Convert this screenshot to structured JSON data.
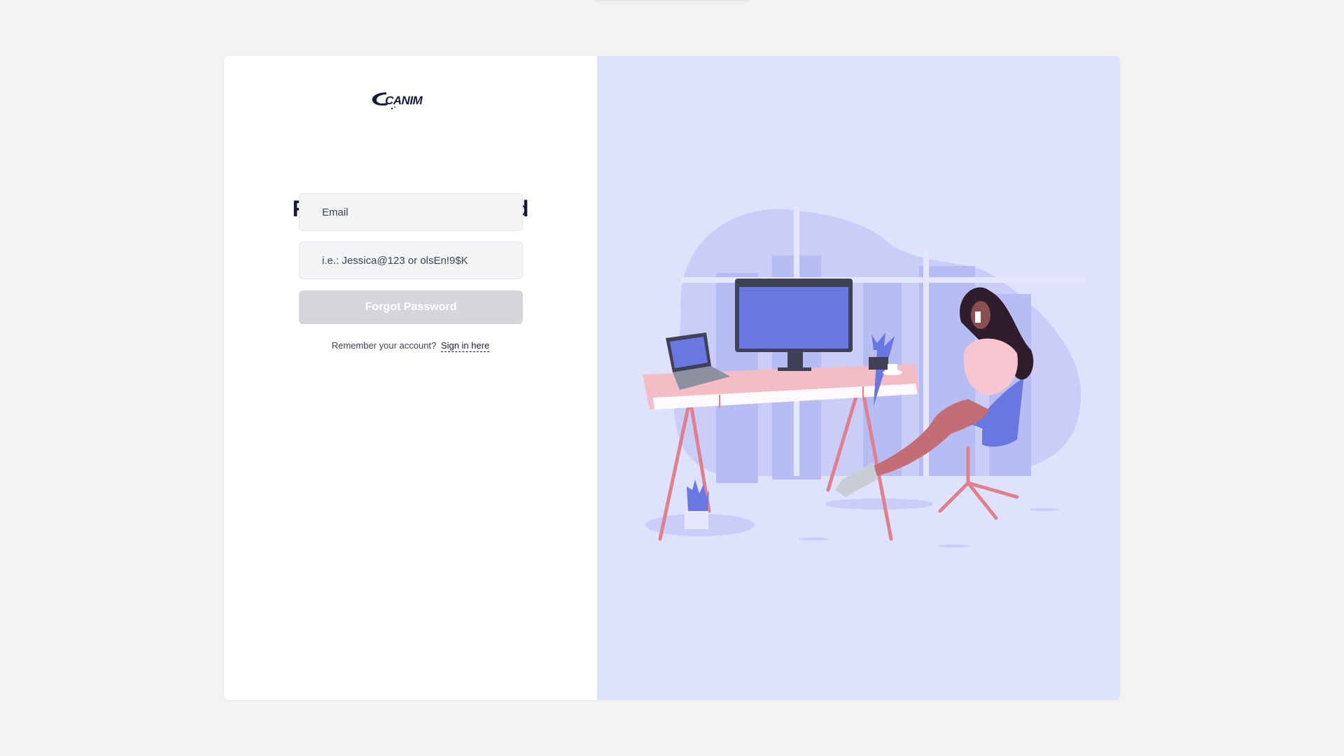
{
  "brand": {
    "logo_text": "CANIM"
  },
  "form": {
    "title": "Forgot your password",
    "email_placeholder": "Email",
    "password_placeholder": "i.e.: Jessica@123 or olsEn!9$K",
    "submit_label": "Forgot Password",
    "remember_text": "Remember your account?",
    "signin_link": "Sign in here"
  },
  "colors": {
    "page_bg": "#f2f3f5",
    "illustration_bg": "#dfe2fc",
    "accent_blue": "#6a77e3",
    "desk_pink": "#f4bcc6",
    "button_disabled": "#d4d6dc"
  },
  "illustration": {
    "name": "woman-at-desk-illustration"
  }
}
